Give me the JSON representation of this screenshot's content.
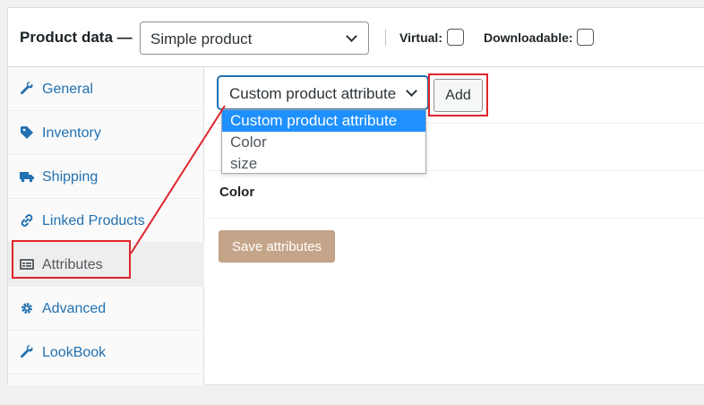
{
  "header": {
    "title": "Product data —",
    "product_type": "Simple product",
    "virtual_label": "Virtual:",
    "downloadable_label": "Downloadable:"
  },
  "tabs": [
    {
      "label": "General",
      "icon": "wrench-icon"
    },
    {
      "label": "Inventory",
      "icon": "tag-icon"
    },
    {
      "label": "Shipping",
      "icon": "truck-icon"
    },
    {
      "label": "Linked Products",
      "icon": "link-icon"
    },
    {
      "label": "Attributes",
      "icon": "list-icon",
      "active": true
    },
    {
      "label": "Advanced",
      "icon": "gear-icon"
    },
    {
      "label": "LookBook",
      "icon": "wrench-icon"
    }
  ],
  "attributes": {
    "selected": "Custom product attribute",
    "add_label": "Add",
    "options": [
      "Custom product attribute",
      "Color",
      "size"
    ],
    "rows": [
      "Color"
    ],
    "save_label": "Save attributes"
  },
  "colors": {
    "link": "#2271b1",
    "highlight": "#e0242b",
    "save_button": "#c5a58a",
    "dropdown_selected": "#1e90ff"
  }
}
